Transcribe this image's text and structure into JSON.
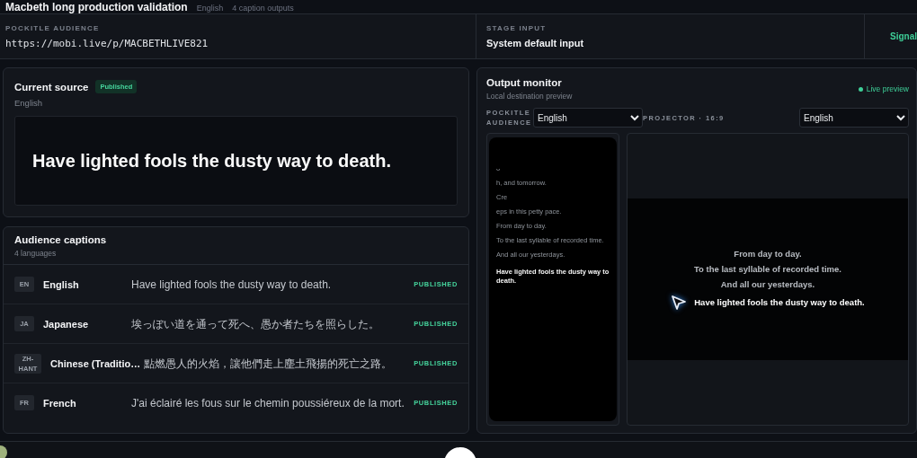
{
  "header": {
    "title": "Macbeth long production validation",
    "language": "English",
    "outputs": "4 caption outputs"
  },
  "info_bar": {
    "audience_label": "POCKITLE AUDIENCE",
    "audience_url": "https://mobi.live/p/MACBETHLIVE821",
    "stage_label": "STAGE INPUT",
    "stage_value": "System default input",
    "signal": "Signal"
  },
  "current_source": {
    "title": "Current source",
    "badge": "Published",
    "language": "English",
    "text": "Have lighted fools the dusty way to death."
  },
  "audience_captions": {
    "title": "Audience captions",
    "subtitle": "4 languages",
    "rows": [
      {
        "code": "EN",
        "language": "English",
        "caption": "Have lighted fools the dusty way to death.",
        "status": "PUBLISHED"
      },
      {
        "code": "JA",
        "language": "Japanese",
        "caption": "埃っぽい道を通って死へ、愚か者たちを照らした。",
        "status": "PUBLISHED"
      },
      {
        "code": "ZH-HANT",
        "language": "Chinese (Traditio…",
        "caption": "點燃愚人的火焰，讓他們走上塵土飛揚的死亡之路。",
        "status": "PUBLISHED"
      },
      {
        "code": "FR",
        "language": "French",
        "caption": "J'ai éclairé les fous sur le chemin poussiéreux de la mort.",
        "status": "PUBLISHED"
      }
    ]
  },
  "output_monitor": {
    "title": "Output monitor",
    "subtitle": "Local destination preview",
    "live": "Live preview",
    "audience_label": "POCKITLE AUDIENCE",
    "audience_language": "English",
    "projector_label": "PROJECTOR · 16:9",
    "projector_language": "English",
    "phone_lines": [
      {
        "text": "ᴗ",
        "current": false
      },
      {
        "text": "h, and tomorrow.",
        "current": false
      },
      {
        "text": "Cre",
        "current": false
      },
      {
        "text": "eps in this petty pace.",
        "current": false
      },
      {
        "text": "From day to day.",
        "current": false
      },
      {
        "text": "To the last syllable of recorded time.",
        "current": false
      },
      {
        "text": "And all our yesterdays.",
        "current": false
      },
      {
        "text": "Have lighted fools the dusty way to death.",
        "current": true
      }
    ],
    "projector_lines": [
      {
        "text": "From day to day.",
        "current": false
      },
      {
        "text": "To the last syllable of recorded time.",
        "current": false
      },
      {
        "text": "And all our yesterdays.",
        "current": false
      },
      {
        "text": "Have lighted fools the dusty way to death.",
        "current": true
      }
    ]
  }
}
